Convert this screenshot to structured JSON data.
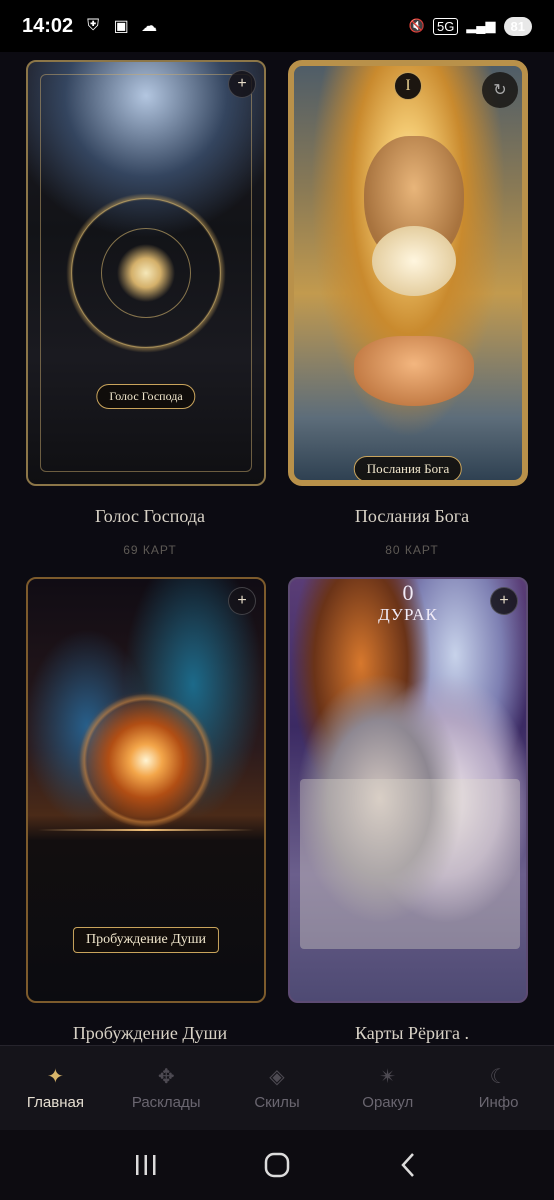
{
  "status_bar": {
    "time": "14:02",
    "network": "5G",
    "battery": "81",
    "left_icons": [
      "vpn-shield-icon",
      "screenshot-icon",
      "cloud-upload-icon"
    ],
    "right_icons": [
      "mute-icon",
      "signal-icon",
      "battery-icon"
    ]
  },
  "decks": [
    {
      "title": "Голос Господа",
      "count": "69 КАРТ",
      "card_caption": "Голос Господа"
    },
    {
      "title": "Послания Бога",
      "count": "80 КАРТ",
      "card_caption": "Послания Бога",
      "card_numeral": "I"
    },
    {
      "title": "Пробуждение Души",
      "card_caption": "Пробуждение Души"
    },
    {
      "title": "Карты Рёрига .",
      "card_numeral": "0",
      "card_name": "ДУРАК"
    }
  ],
  "add_button_label": "+",
  "bottom_nav": {
    "items": [
      {
        "label": "Главная",
        "icon": "sparkle-icon",
        "glyph": "✦"
      },
      {
        "label": "Расклады",
        "icon": "spread-icon",
        "glyph": "✥"
      },
      {
        "label": "Скилы",
        "icon": "diamond-icon",
        "glyph": "◈"
      },
      {
        "label": "Оракул",
        "icon": "star-burst-icon",
        "glyph": "✴"
      },
      {
        "label": "Инфо",
        "icon": "moon-icon",
        "glyph": "☾"
      }
    ],
    "active": "Главная"
  },
  "colors": {
    "accent": "#d8b56a",
    "background": "#0c0b12",
    "nav_background": "#15141a"
  }
}
